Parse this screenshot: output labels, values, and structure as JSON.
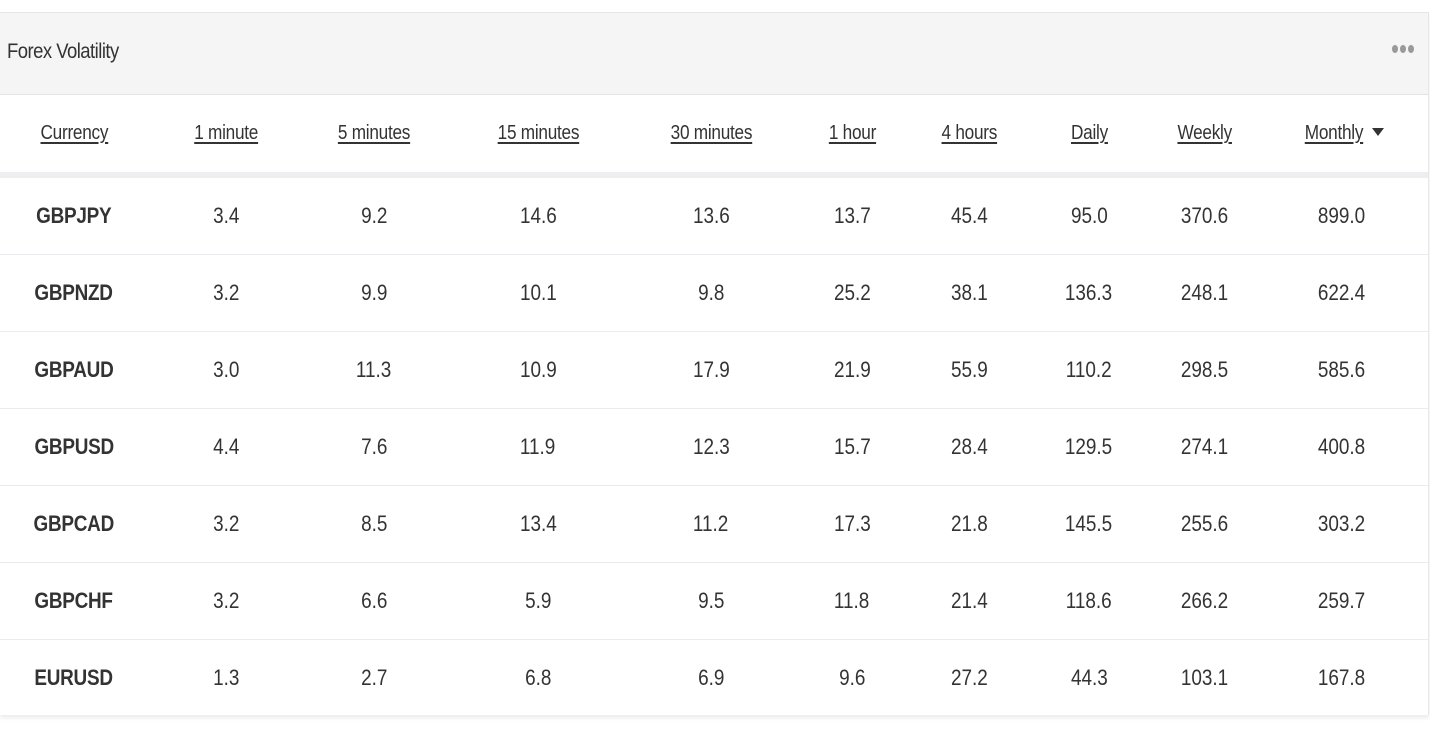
{
  "widget": {
    "title": "Forex Volatility",
    "menu_icon": "more-horizontal-icon"
  },
  "table": {
    "columns": [
      {
        "key": "currency",
        "label": "Currency"
      },
      {
        "key": "m1",
        "label": "1 minute"
      },
      {
        "key": "m5",
        "label": "5 minutes"
      },
      {
        "key": "m15",
        "label": "15 minutes"
      },
      {
        "key": "m30",
        "label": "30 minutes"
      },
      {
        "key": "h1",
        "label": "1 hour"
      },
      {
        "key": "h4",
        "label": "4 hours"
      },
      {
        "key": "daily",
        "label": "Daily"
      },
      {
        "key": "weekly",
        "label": "Weekly"
      },
      {
        "key": "monthly",
        "label": "Monthly",
        "sorted": "desc",
        "sort_icon": "caret-down-icon"
      }
    ],
    "rows": [
      [
        "GBPJPY",
        "3.4",
        "9.2",
        "14.6",
        "13.6",
        "13.7",
        "45.4",
        "95.0",
        "370.6",
        "899.0"
      ],
      [
        "GBPNZD",
        "3.2",
        "9.9",
        "10.1",
        "9.8",
        "25.2",
        "38.1",
        "136.3",
        "248.1",
        "622.4"
      ],
      [
        "GBPAUD",
        "3.0",
        "11.3",
        "10.9",
        "17.9",
        "21.9",
        "55.9",
        "110.2",
        "298.5",
        "585.6"
      ],
      [
        "GBPUSD",
        "4.4",
        "7.6",
        "11.9",
        "12.3",
        "15.7",
        "28.4",
        "129.5",
        "274.1",
        "400.8"
      ],
      [
        "GBPCAD",
        "3.2",
        "8.5",
        "13.4",
        "11.2",
        "17.3",
        "21.8",
        "145.5",
        "255.6",
        "303.2"
      ],
      [
        "GBPCHF",
        "3.2",
        "6.6",
        "5.9",
        "9.5",
        "11.8",
        "21.4",
        "118.6",
        "266.2",
        "259.7"
      ],
      [
        "EURUSD",
        "1.3",
        "2.7",
        "6.8",
        "6.9",
        "9.6",
        "27.2",
        "44.3",
        "103.1",
        "167.8"
      ]
    ]
  }
}
